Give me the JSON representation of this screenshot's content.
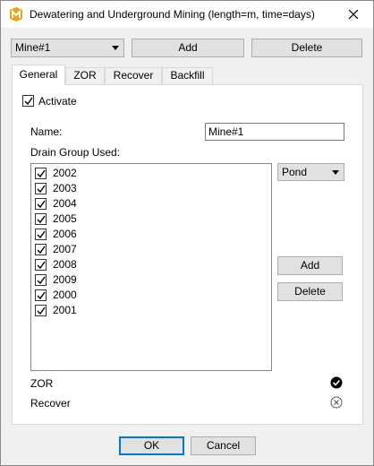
{
  "window": {
    "title": "Dewatering and Underground Mining (length=m, time=days)",
    "app_icon": "m-logo-icon"
  },
  "top": {
    "mine_select": {
      "value": "Mine#1"
    },
    "add_label": "Add",
    "delete_label": "Delete"
  },
  "tabs": [
    {
      "label": "General",
      "active": true
    },
    {
      "label": "ZOR",
      "active": false
    },
    {
      "label": "Recover",
      "active": false
    },
    {
      "label": "Backfill",
      "active": false
    }
  ],
  "general": {
    "activate_label": "Activate",
    "activate_checked": true,
    "name_label": "Name:",
    "name_value": "Mine#1",
    "drain_group_label": "Drain Group Used:",
    "drain_groups": [
      {
        "label": "2002",
        "checked": true
      },
      {
        "label": "2003",
        "checked": true
      },
      {
        "label": "2004",
        "checked": true
      },
      {
        "label": "2005",
        "checked": true
      },
      {
        "label": "2006",
        "checked": true
      },
      {
        "label": "2007",
        "checked": true
      },
      {
        "label": "2008",
        "checked": true
      },
      {
        "label": "2009",
        "checked": true
      },
      {
        "label": "2000",
        "checked": true
      },
      {
        "label": "2001",
        "checked": true
      }
    ],
    "group_type_select": {
      "value": "Pond"
    },
    "add_label": "Add",
    "delete_label": "Delete",
    "zor_label": "ZOR",
    "zor_status_icon": "check-circle-icon",
    "recover_label": "Recover",
    "recover_status_icon": "x-circle-icon"
  },
  "footer": {
    "ok_label": "OK",
    "cancel_label": "Cancel"
  }
}
